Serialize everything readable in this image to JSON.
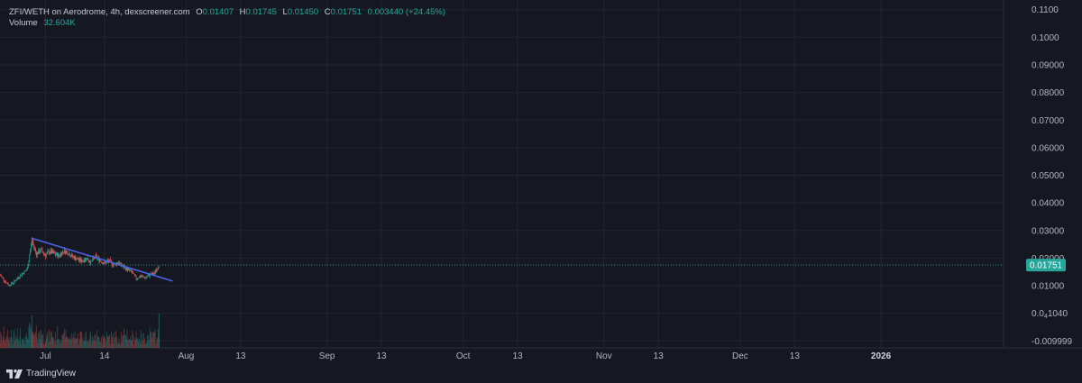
{
  "legend": {
    "symbol": "ZFI/WETH on Aerodrome, 4h, dexscreener.com",
    "o_label": "O",
    "o_value": "0.01407",
    "h_label": "H",
    "h_value": "0.01745",
    "l_label": "L",
    "l_value": "0.01450",
    "c_label": "C",
    "c_value": "0.01751",
    "change": "0.003440 (+24.45%)",
    "volume_label": "Volume",
    "volume_value": "32.604K"
  },
  "footer": {
    "brand": "TradingView",
    "brand_icon": "tradingview-logo-icon"
  },
  "colors": {
    "background": "#161821",
    "grid": "#22252f",
    "up": "#26a69a",
    "down": "#ef5350",
    "trendline": "#4a63e8",
    "last_price": "#26a69a",
    "text": "#b2b5be"
  },
  "chart_data": {
    "type": "candlestick",
    "grid": true,
    "y_axis": {
      "position": "right",
      "ticks": [
        "0.1100",
        "0.1000",
        "0.09000",
        "0.08000",
        "0.07000",
        "0.06000",
        "0.05000",
        "0.04000",
        "0.03000",
        "0.02000",
        "0.01000",
        "-0.009999"
      ],
      "tick_values": [
        0.11,
        0.1,
        0.09,
        0.08,
        0.07,
        0.06,
        0.05,
        0.04,
        0.03,
        0.02,
        0.01,
        -0.009999
      ],
      "special_tick": {
        "value": 1.04e-05,
        "lead": "0.0",
        "sub": "4",
        "tail": "1040"
      },
      "range": [
        -0.0125,
        0.1135
      ]
    },
    "x_axis": {
      "ticks": [
        {
          "label": "Jul",
          "date": "2025-07-01"
        },
        {
          "label": "14",
          "date": "2025-07-14"
        },
        {
          "label": "Aug",
          "date": "2025-08-01"
        },
        {
          "label": "13",
          "date": "2025-08-13"
        },
        {
          "label": "Sep",
          "date": "2025-09-01"
        },
        {
          "label": "13",
          "date": "2025-09-13"
        },
        {
          "label": "Oct",
          "date": "2025-10-01"
        },
        {
          "label": "13",
          "date": "2025-10-13"
        },
        {
          "label": "Nov",
          "date": "2025-11-01"
        },
        {
          "label": "13",
          "date": "2025-11-13"
        },
        {
          "label": "Dec",
          "date": "2025-12-01"
        },
        {
          "label": "13",
          "date": "2025-12-13"
        },
        {
          "label": "2026",
          "date": "2026-01-01",
          "bold": true
        }
      ],
      "range": [
        "2025-06-21",
        "2026-01-28"
      ]
    },
    "last_price": {
      "value": 0.01751,
      "label": "0.01751"
    },
    "trendline": [
      {
        "date": "2025-06-28",
        "value": 0.0272
      },
      {
        "date": "2025-07-29",
        "value": 0.0117
      }
    ],
    "price_path": [
      [
        "2025-06-21",
        0.014
      ],
      [
        "2025-06-22",
        0.0118
      ],
      [
        "2025-06-23",
        0.0102
      ],
      [
        "2025-06-24",
        0.0112
      ],
      [
        "2025-06-25",
        0.013
      ],
      [
        "2025-06-26",
        0.0145
      ],
      [
        "2025-06-27",
        0.016
      ],
      [
        "2025-06-28",
        0.0265
      ],
      [
        "2025-06-29",
        0.0215
      ],
      [
        "2025-06-30",
        0.023
      ],
      [
        "2025-07-01",
        0.021
      ],
      [
        "2025-07-02",
        0.0225
      ],
      [
        "2025-07-03",
        0.0215
      ],
      [
        "2025-07-04",
        0.0208
      ],
      [
        "2025-07-05",
        0.0228
      ],
      [
        "2025-07-06",
        0.022
      ],
      [
        "2025-07-07",
        0.0205
      ],
      [
        "2025-07-08",
        0.0196
      ],
      [
        "2025-07-09",
        0.019
      ],
      [
        "2025-07-10",
        0.02
      ],
      [
        "2025-07-11",
        0.0185
      ],
      [
        "2025-07-12",
        0.0205
      ],
      [
        "2025-07-13",
        0.0192
      ],
      [
        "2025-07-14",
        0.0182
      ],
      [
        "2025-07-15",
        0.019
      ],
      [
        "2025-07-16",
        0.0175
      ],
      [
        "2025-07-17",
        0.0185
      ],
      [
        "2025-07-18",
        0.017
      ],
      [
        "2025-07-19",
        0.016
      ],
      [
        "2025-07-20",
        0.015
      ],
      [
        "2025-07-21",
        0.0125
      ],
      [
        "2025-07-22",
        0.0135
      ],
      [
        "2025-07-23",
        0.0128
      ],
      [
        "2025-07-24",
        0.014
      ],
      [
        "2025-07-25",
        0.0145
      ],
      [
        "2025-07-26",
        0.0175
      ]
    ]
  }
}
